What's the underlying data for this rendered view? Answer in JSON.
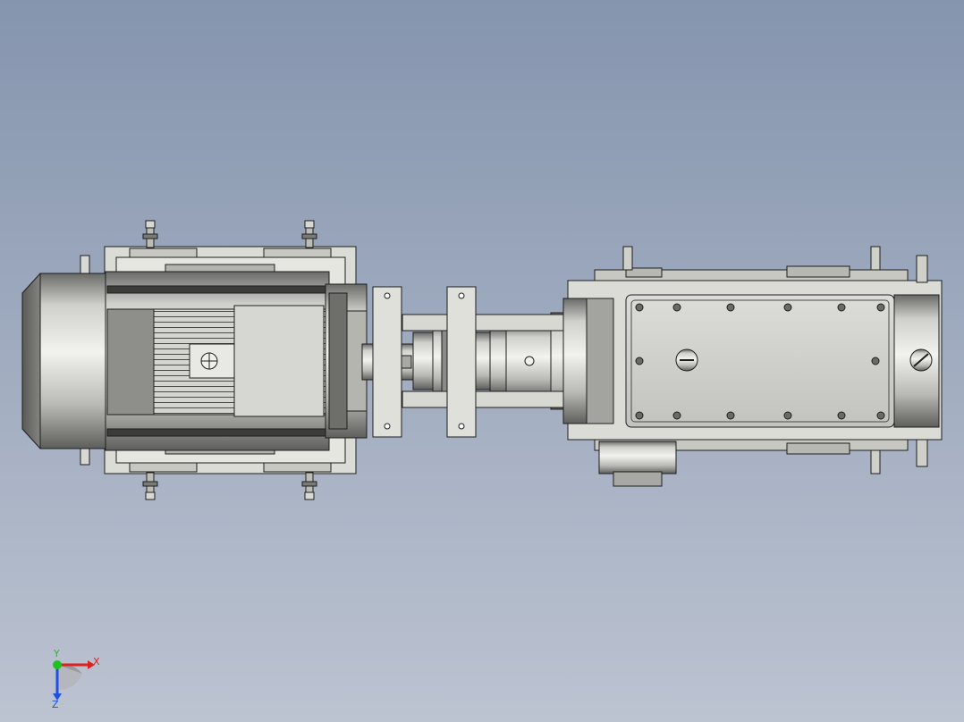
{
  "viewport": {
    "background_top": "#8595ae",
    "background_bottom": "#bcc3d1"
  },
  "model": {
    "components": [
      "motor",
      "motor-base",
      "coupling",
      "support-bracket",
      "gearbox"
    ],
    "colors": {
      "metal_light": "#e4e4e4",
      "metal_mid": "#c6c6c2",
      "metal_dark": "#8a8a86",
      "metal_shadow": "#5a5a58",
      "outline": "#1e1e1e"
    }
  },
  "triad": {
    "x_label": "X",
    "y_label": "Y",
    "z_label": "Z",
    "x_color": "#e02020",
    "y_color": "#20c020",
    "z_color": "#2050e0"
  }
}
